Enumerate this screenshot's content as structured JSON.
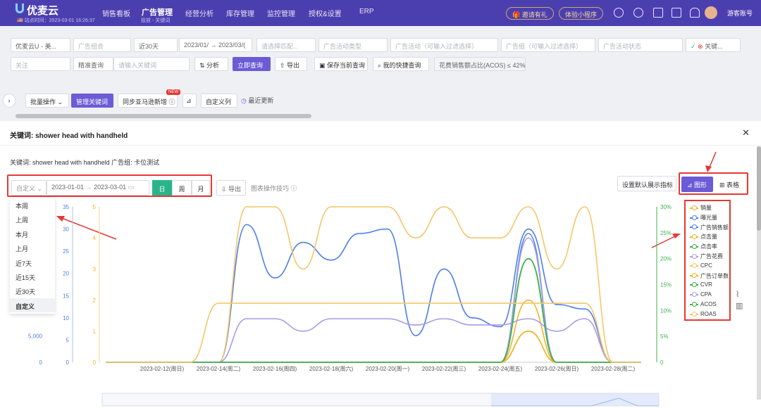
{
  "app": {
    "logo": "优麦云",
    "logo_sub": "🇺🇸 站点时间：2023-03-01 16:26:37",
    "nav": [
      "销售看板",
      "广告管理",
      "经营分析",
      "库存管理",
      "监控管理",
      "授权&设置",
      "ERP"
    ],
    "nav_active": 1,
    "nav_sub": "投放 - 关键词",
    "invite": "邀请有礼",
    "miniapp": "体验小程序",
    "user": "游客账号"
  },
  "filters": {
    "row1": [
      "优麦云U - 美...",
      "广告组合",
      "近30天",
      "2023/01/ → 2023/03/(",
      "请选择匹配...",
      "广告活动类型",
      "广告活动（可输入过滤选择）",
      "广告组（可输入过滤选择）",
      "广告活动状态",
      "关键..."
    ],
    "row2": {
      "follow": "关注",
      "exact": "精准查询",
      "keyword_placeholder": "请输入关键词",
      "analyze": "分析",
      "query": "立即查询",
      "export": "导出",
      "save_query": "保存当前查询",
      "my_query": "我的快捷查询",
      "acos": "花费销售额占比(ACOS) ≤ 42%"
    },
    "row3": {
      "batch": "批量操作",
      "manage": "管理关键词",
      "sync": "同步亚马逊新增",
      "new_badge": "NEW",
      "custom_cols": "自定义列",
      "recent": "最近更新"
    }
  },
  "modal": {
    "title": "关键词: shower head with handheld",
    "info": "关键词: shower head with handheld   广告组: 卡位测试",
    "range_type": "自定义",
    "start": "2023-01-01",
    "end": "2023-03-01",
    "granularity": [
      "日",
      "周",
      "月"
    ],
    "granularity_active": 0,
    "export": "导出",
    "tips": "图表操作技巧",
    "set_default": "设置默认展示指标",
    "view_chart": "图形",
    "view_table": "表格",
    "range_options": [
      "本周",
      "上周",
      "本月",
      "上月",
      "近7天",
      "近15天",
      "近30天",
      "自定义"
    ],
    "range_selected": 7
  },
  "chart_data": {
    "type": "line",
    "x": [
      "2023-02-10",
      "2023-02-11",
      "2023-02-12",
      "2023-02-13",
      "2023-02-14",
      "2023-02-15",
      "2023-02-16",
      "2023-02-17",
      "2023-02-18",
      "2023-02-19",
      "2023-02-20",
      "2023-02-21",
      "2023-02-22",
      "2023-02-23",
      "2023-02-24",
      "2023-02-25",
      "2023-02-26",
      "2023-02-27",
      "2023-02-28",
      "2023-03-01"
    ],
    "xticks": [
      "2023-02-12(周日)",
      "2023-02-14(周二)",
      "2023-02-16(周四)",
      "2023-02-18(周六)",
      "2023-02-20(周一)",
      "2023-02-22(周三)",
      "2023-02-24(周五)",
      "2023-02-26(周日)",
      "2023-02-28(周二)"
    ],
    "axes": [
      {
        "id": "a1",
        "ticks": [
          "0",
          "5,000"
        ],
        "color": "#4d7ee8"
      },
      {
        "id": "a2",
        "ticks": [
          "0",
          "5",
          "10",
          "15",
          "20",
          "25",
          "30",
          "35"
        ],
        "color": "#4d7ee8"
      },
      {
        "id": "a3",
        "ticks": [
          "0",
          "1",
          "2",
          "3",
          "4",
          "5"
        ],
        "color": "#f0b429"
      },
      {
        "id": "a4",
        "ticks": [
          "0",
          "5%",
          "10%",
          "15%",
          "20%",
          "25%",
          "30%"
        ],
        "color": "#3cb34a"
      }
    ],
    "series": [
      {
        "name": "销量",
        "color": "#f0b429",
        "axis": "a3",
        "ymax": 5,
        "values": [
          0,
          0,
          0,
          0,
          0,
          0,
          0,
          0,
          0,
          0,
          0,
          0,
          0,
          0,
          0,
          1,
          0,
          0,
          0,
          0
        ]
      },
      {
        "name": "曝光量",
        "color": "#4d7ee8",
        "axis": "a2",
        "ymax": 35,
        "values": [
          0,
          0,
          0,
          0,
          0,
          31,
          19,
          27,
          23,
          29,
          30,
          6,
          21,
          10,
          8,
          30,
          13,
          12,
          0,
          0
        ]
      },
      {
        "name": "广告销售额",
        "color": "#4d7ee8",
        "axis": "a2",
        "ymax": 35,
        "values": [
          0,
          0,
          0,
          0,
          0,
          0,
          0,
          0,
          0,
          0,
          0,
          0,
          0,
          0,
          0,
          29,
          0,
          0,
          0,
          0
        ]
      },
      {
        "name": "点击量",
        "color": "#f0b429",
        "axis": "a3",
        "ymax": 5,
        "values": [
          0,
          0,
          0,
          0,
          0,
          0,
          0,
          0,
          0,
          0,
          0,
          0,
          0,
          0,
          0,
          2,
          0,
          0,
          0,
          0
        ]
      },
      {
        "name": "点击率",
        "color": "#3cb34a",
        "axis": "a4",
        "ymax": 0.3,
        "values": [
          0,
          0,
          0,
          0,
          0,
          0,
          0,
          0,
          0,
          0,
          0,
          0,
          0,
          0,
          0,
          0.2,
          0,
          0,
          0,
          0
        ]
      },
      {
        "name": "广告花费",
        "color": "#a99be8",
        "axis": "a3",
        "ymax": 5,
        "values": [
          0,
          0,
          0,
          0,
          0,
          1.4,
          1.4,
          1.0,
          1.4,
          1.4,
          1.4,
          1.2,
          1.4,
          1.2,
          1.2,
          1.4,
          1.0,
          1.4,
          0,
          0
        ]
      },
      {
        "name": "CPC",
        "color": "#f5c66a",
        "axis": "a4",
        "ymax": 0.3,
        "values": [
          0,
          0,
          0,
          0,
          0,
          0.3,
          0.3,
          0.18,
          0.3,
          0.3,
          0.3,
          0.24,
          0.3,
          0.24,
          0.24,
          0.3,
          0.18,
          0.3,
          0,
          0
        ]
      },
      {
        "name": "广告订单数",
        "color": "#f0b429",
        "axis": "a3",
        "ymax": 5,
        "values": [
          0,
          0,
          0,
          0,
          0,
          0,
          0,
          0,
          0,
          0,
          0,
          0,
          0,
          0,
          0,
          1,
          0,
          0,
          0,
          0
        ]
      },
      {
        "name": "CVR",
        "color": "#3cb34a",
        "axis": "a4",
        "ymax": 0.3,
        "values": [
          0,
          0,
          0,
          0,
          0,
          0,
          0,
          0,
          0,
          0,
          0,
          0,
          0,
          0,
          0,
          0.2,
          0,
          0,
          0,
          0
        ]
      },
      {
        "name": "CPA",
        "color": "#a99be8",
        "axis": "a3",
        "ymax": 5,
        "values": [
          0,
          0,
          0,
          0,
          0,
          0,
          0,
          0,
          0,
          0,
          0,
          0,
          0,
          0,
          0,
          4,
          0,
          0,
          0,
          0
        ]
      },
      {
        "name": "ACOS",
        "color": "#3cb34a",
        "axis": "a4",
        "ymax": 0.3,
        "values": [
          0,
          0,
          0,
          0,
          0,
          0,
          0,
          0,
          0,
          0,
          0,
          0,
          0,
          0,
          0,
          0.2,
          0,
          0,
          0,
          0
        ]
      },
      {
        "name": "ROAS",
        "color": "#f5c66a",
        "axis": "a3",
        "ymax": 5,
        "values": [
          0,
          0,
          0,
          0,
          1.9,
          1.9,
          1.9,
          1.9,
          1.9,
          1.9,
          1.9,
          1.9,
          1.9,
          1.9,
          1.9,
          1.9,
          1.9,
          1.9,
          0,
          0
        ]
      }
    ]
  }
}
